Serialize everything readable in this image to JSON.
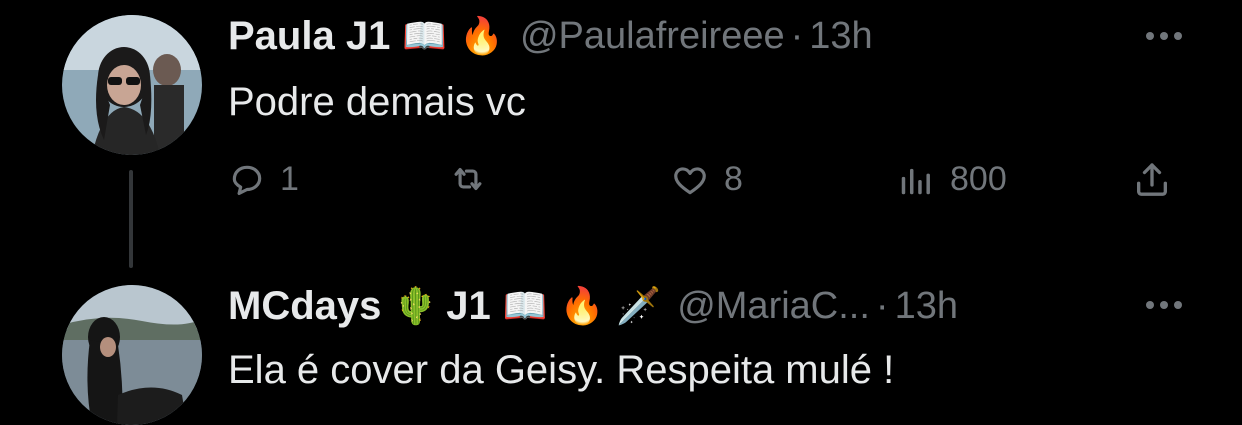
{
  "tweets": [
    {
      "name": "Paula J1",
      "emojis": [
        "📖",
        "🔥"
      ],
      "handle": "@Paulafreireee",
      "separator": "·",
      "time": "13h",
      "text": "Podre demais vc",
      "actions": {
        "replies": "1",
        "retweets": "",
        "likes": "8",
        "views": "800"
      }
    },
    {
      "name": "MCdays",
      "emojis": [
        "🌵",
        "J1",
        "📖",
        "🔥",
        "🗡️"
      ],
      "handle": "@MariaC...",
      "separator": "·",
      "time": "13h",
      "text": "Ela é cover da Geisy. Respeita mulé !"
    }
  ],
  "icons": [
    "reply-icon",
    "retweet-icon",
    "like-icon",
    "views-icon",
    "share-icon",
    "more-icon"
  ],
  "colors": {
    "background": "#000000",
    "text": "#e7e9ea",
    "muted": "#71767b"
  }
}
